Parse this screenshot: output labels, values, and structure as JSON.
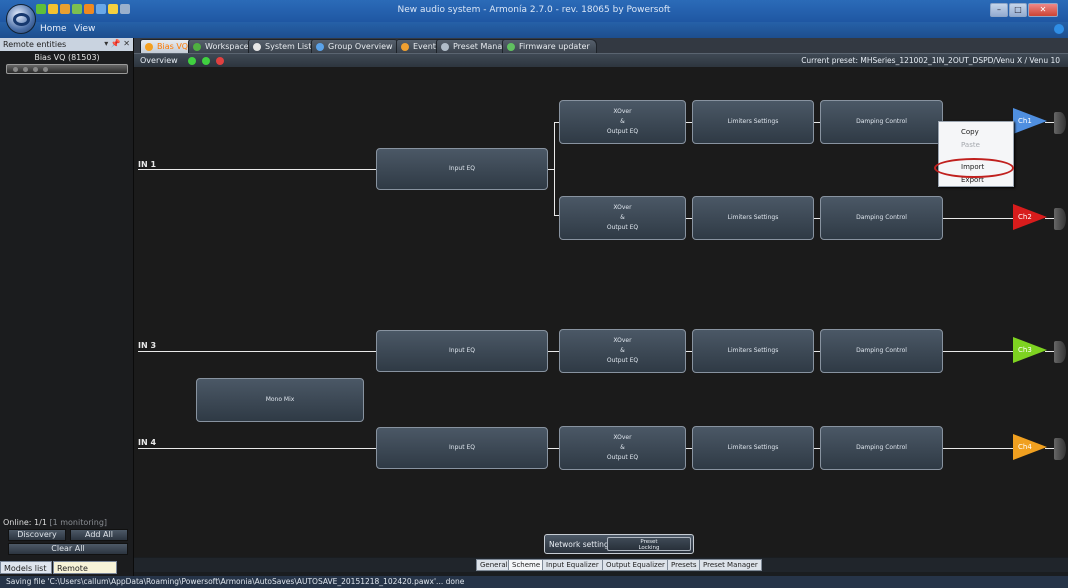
{
  "window": {
    "title": "New audio system - Armonía 2.7.0 - rev. 18065 by Powersoft",
    "minimize": "–",
    "maximize": "□",
    "close": "✕"
  },
  "ribbon": {
    "tabs": [
      "Home",
      "View"
    ]
  },
  "left_panel": {
    "header": "Remote entities",
    "header_controls": "▾ 📌 ✕",
    "device_name": "Bias VQ (81503)",
    "online_label": "Online: 1/1",
    "online_monitoring": "[1 monitoring]",
    "discovery": "Discovery",
    "add_all": "Add All",
    "clear_all": "Clear All",
    "tabs": [
      "Models list",
      "Remote entities"
    ]
  },
  "doc_tabs": [
    "Bias VQ",
    "Workspace",
    "System List",
    "Group Overview",
    "Events",
    "Preset Manager",
    "Firmware updater"
  ],
  "overview": {
    "label": "Overview",
    "current_preset": "Current preset: MHSeries_121002_1IN_2OUT_DSPD/Venu X / Venu 10"
  },
  "scheme": {
    "inputs": [
      "IN 1",
      "IN 3",
      "IN 4"
    ],
    "input_eq": "Input EQ",
    "xover": [
      "XOver",
      "&",
      "Output EQ"
    ],
    "limiters": "Limiters Settings",
    "damping": "Damping Control",
    "mono_mix": "Mono Mix",
    "channels": [
      "Ch1",
      "Ch2",
      "Ch3",
      "Ch4"
    ],
    "channel_colors": [
      "#4f8fe0",
      "#d81c1c",
      "#7ed321",
      "#f0a020"
    ]
  },
  "context_menu": {
    "items": [
      "Copy",
      "Paste",
      "Import",
      "Export"
    ],
    "disabled": [
      "Paste"
    ]
  },
  "network": {
    "label": "Network settings",
    "preset_locking": [
      "Preset",
      "Locking"
    ]
  },
  "bottom_tabs": [
    "General",
    "Scheme",
    "Input Equalizer",
    "Output Equalizer",
    "Presets",
    "Preset Manager"
  ],
  "status": "Saving file 'C:\\Users\\callum\\AppData\\Roaming\\Powersoft\\Armonia\\AutoSaves\\AUTOSAVE_20151218_102420.pawx'... done"
}
